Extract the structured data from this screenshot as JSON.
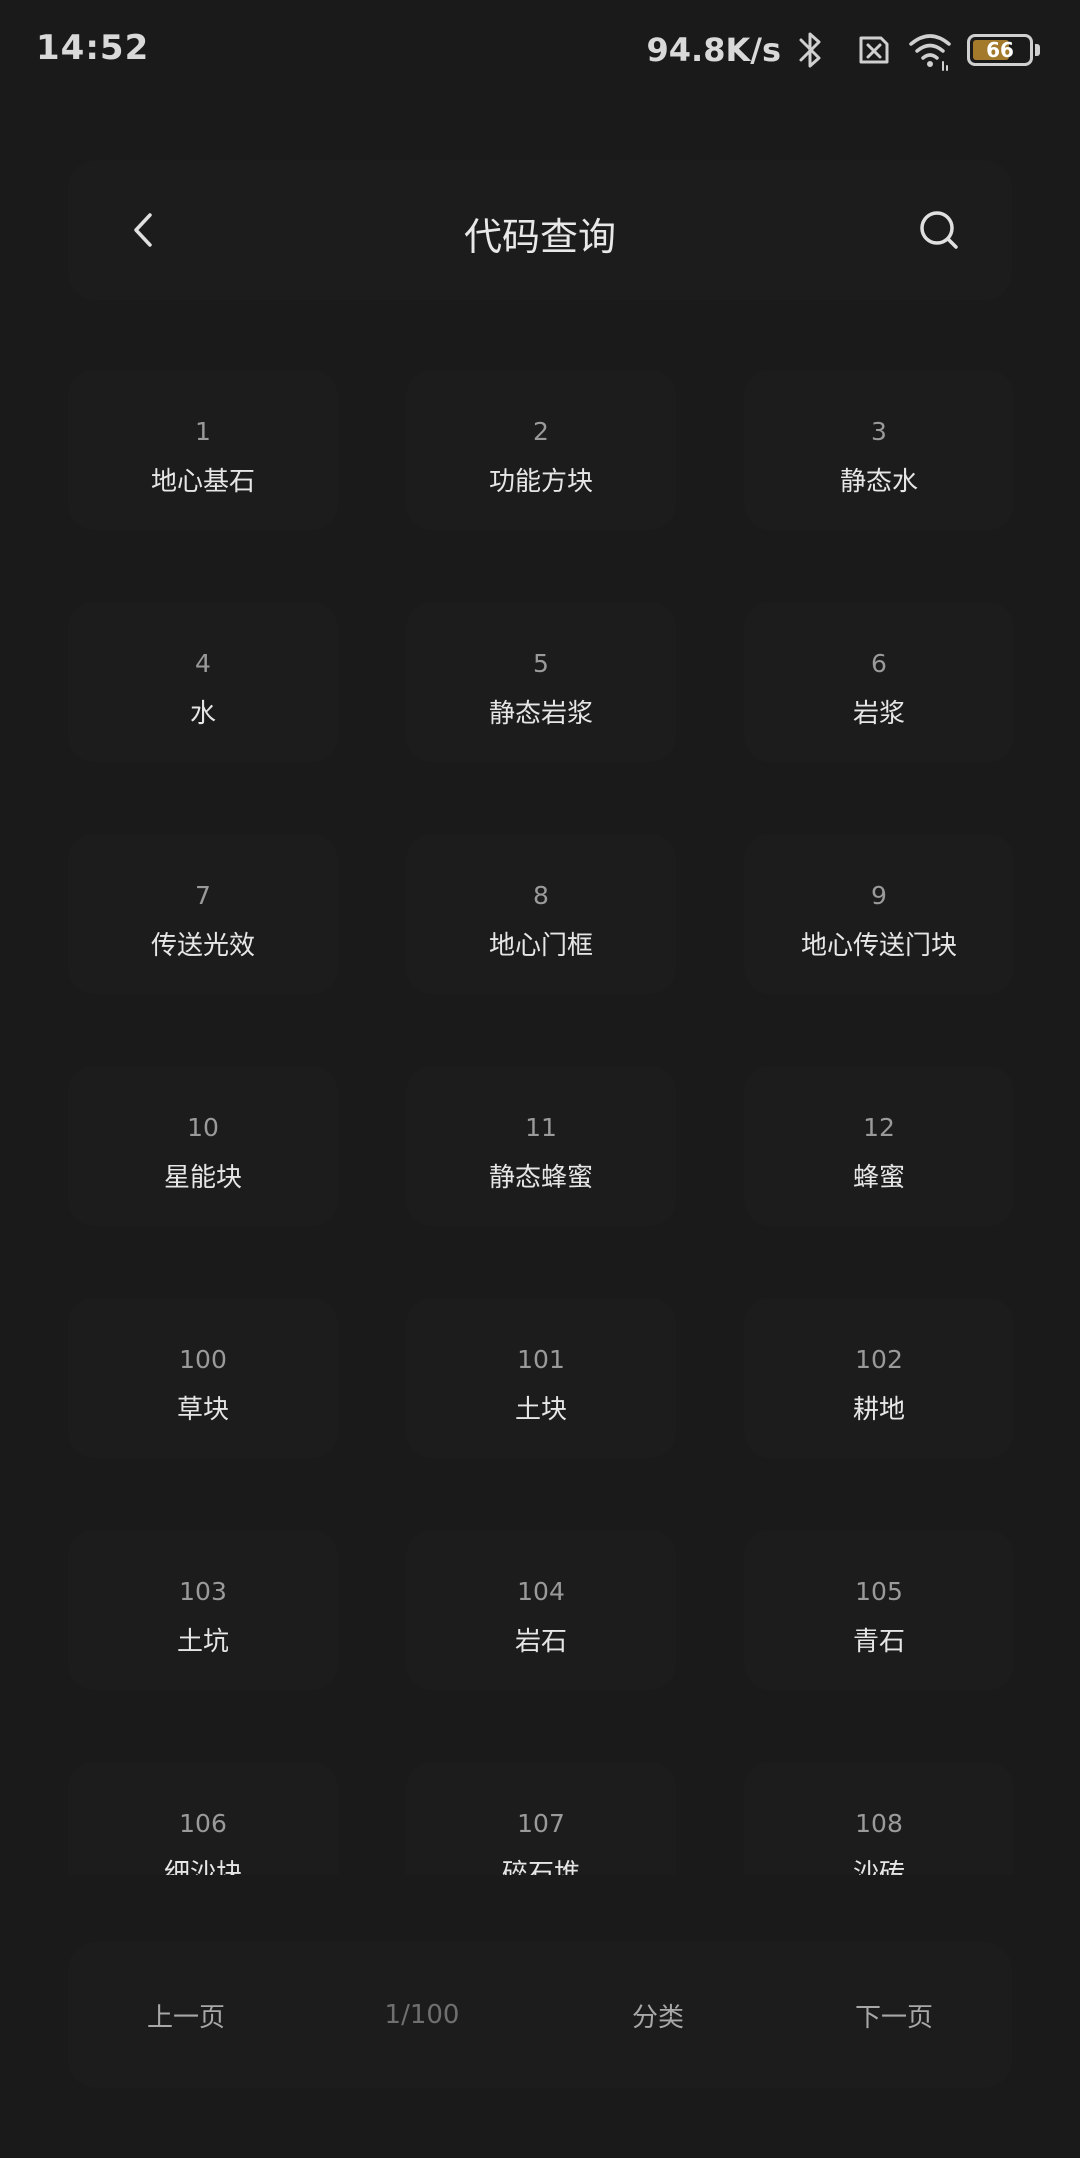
{
  "status_bar": {
    "time": "14:52",
    "net_speed": "94.8K/s",
    "battery_level": "66",
    "battery_fill_fraction": 0.66,
    "icons": [
      "bluetooth-icon",
      "sim-disabled-icon",
      "wifi-icon",
      "battery-icon"
    ]
  },
  "header": {
    "title": "代码查询",
    "back_icon": "chevron-left-icon",
    "search_icon": "search-icon"
  },
  "blocks": [
    {
      "code": "1",
      "name": "地心基石"
    },
    {
      "code": "2",
      "name": "功能方块"
    },
    {
      "code": "3",
      "name": "静态水"
    },
    {
      "code": "4",
      "name": "水"
    },
    {
      "code": "5",
      "name": "静态岩浆"
    },
    {
      "code": "6",
      "name": "岩浆"
    },
    {
      "code": "7",
      "name": "传送光效"
    },
    {
      "code": "8",
      "name": "地心门框"
    },
    {
      "code": "9",
      "name": "地心传送门块"
    },
    {
      "code": "10",
      "name": "星能块"
    },
    {
      "code": "11",
      "name": "静态蜂蜜"
    },
    {
      "code": "12",
      "name": "蜂蜜"
    },
    {
      "code": "100",
      "name": "草块"
    },
    {
      "code": "101",
      "name": "土块"
    },
    {
      "code": "102",
      "name": "耕地"
    },
    {
      "code": "103",
      "name": "土坑"
    },
    {
      "code": "104",
      "name": "岩石"
    },
    {
      "code": "105",
      "name": "青石"
    },
    {
      "code": "106",
      "name": "细沙块"
    },
    {
      "code": "107",
      "name": "碎石堆"
    },
    {
      "code": "108",
      "name": "沙砖"
    }
  ],
  "pagination": {
    "prev_label": "上一页",
    "page_indicator": "1/100",
    "category_label": "分类",
    "next_label": "下一页"
  },
  "colors": {
    "background": "#1a1a1a",
    "card": "#1c1c1c",
    "battery_fill": "#a37a2c"
  }
}
